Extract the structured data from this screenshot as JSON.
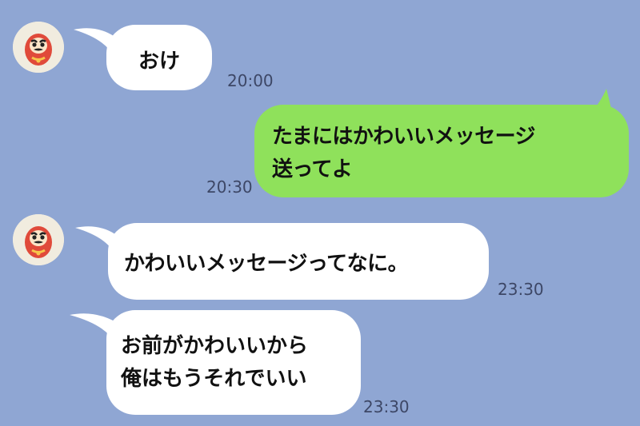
{
  "colors": {
    "background": "#8fa6d3",
    "incoming_bubble": "#ffffff",
    "outgoing_bubble": "#8fe15b",
    "timestamp": "#3d4766"
  },
  "avatar_icon": "daruma-icon",
  "messages": [
    {
      "direction": "incoming",
      "text": "おけ",
      "time": "20:00"
    },
    {
      "direction": "outgoing",
      "text": "たまにはかわいいメッセージ\n送ってよ",
      "time": "20:30"
    },
    {
      "direction": "incoming",
      "text": "かわいいメッセージってなに。",
      "time": "23:30"
    },
    {
      "direction": "incoming",
      "text": "お前がかわいいから\n俺はもうそれでいい",
      "time": "23:30"
    }
  ]
}
